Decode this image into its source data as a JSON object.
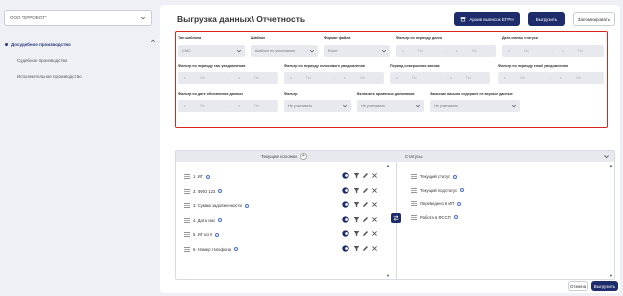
{
  "sidebar": {
    "org_value": "ООО \"ЕРРОБОТ\"",
    "items": [
      {
        "label": "Досудебное производство",
        "active": true
      },
      {
        "label": "Судебное производство",
        "active": false
      },
      {
        "label": "Исполнительное производство",
        "active": false
      }
    ]
  },
  "header": {
    "title": "Выгрузка данных\\ Отчетность",
    "btn_archive": "Архив выписок ЕГРН",
    "btn_export": "Выгрузить",
    "btn_remember": "Запомнировать"
  },
  "filters": {
    "template": {
      "label": "Тип шаблона",
      "value": "СМС"
    },
    "pattern": {
      "label": "Шаблон",
      "value": "Шаблон по умолчанию"
    },
    "format": {
      "label": "Формат файла",
      "value": "Excel"
    },
    "debt_period": {
      "label": "Фильтр по периоду долга",
      "from": "с",
      "to": "По"
    },
    "status_date": {
      "label": "Дата смены статуса",
      "from": "с",
      "to": "По"
    },
    "sms_period": {
      "label": "Фильтр по периоду смс уведомления",
      "from": "с",
      "to": "По"
    },
    "voice_period": {
      "label": "Фильтр по периоду голосового уведомления",
      "from": "с",
      "to": "По"
    },
    "call_period": {
      "label": "Период совершения звонка",
      "from": "с",
      "to": "По"
    },
    "email_period": {
      "label": "Фильтр по периоду email уведомления",
      "from": "с",
      "to": "По"
    },
    "appeal_date": {
      "label": "Фильтр по дате обновления данных",
      "from": "с",
      "to": "По"
    },
    "prefix": {
      "label": "Фильтр",
      "value": "Не учитывать"
    },
    "archive": {
      "label": "Включить архивных должников",
      "value": "Не учитывать"
    },
    "email_contains": {
      "label": "Заказчик письмо содержит не верные данные",
      "value": "Не учитывать"
    }
  },
  "columns": {
    "current_label": "Текущие колонки",
    "add_symbol": "+",
    "statuses_label": "Статусы",
    "current": [
      "1. ИГ",
      "2. ФИО 123",
      "3. Сумма задолженности",
      "4. Дата смс",
      "5. ИГ ксгл",
      "6. Номер телефона"
    ],
    "statuses": [
      "Текущий статус",
      "Текущий подстатус",
      "Переведено в ИП",
      "Работа в ФССП"
    ]
  },
  "footer": {
    "cancel": "Отмена",
    "export": "Выгрузить"
  }
}
